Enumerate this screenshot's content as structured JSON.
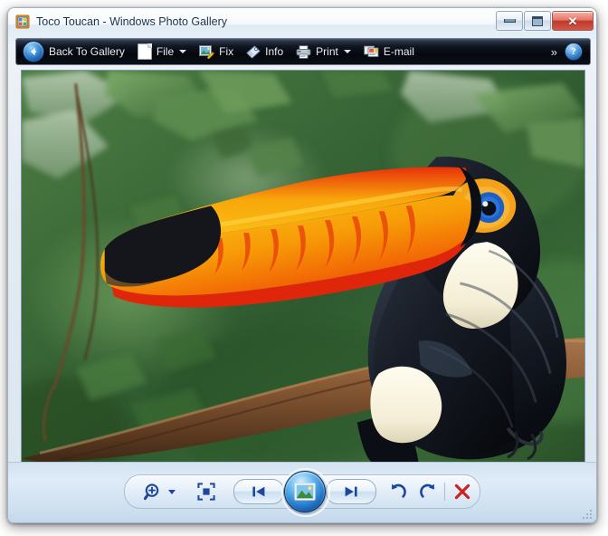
{
  "window": {
    "title": "Toco Toucan - Windows Photo Gallery",
    "icon": "photo-gallery-icon",
    "controls": {
      "minimize_label": "Minimize",
      "maximize_label": "Maximize",
      "close_label": "Close",
      "close_glyph": "✕"
    }
  },
  "toolbar": {
    "back_label": "Back To Gallery",
    "back_icon": "back-arrow-icon",
    "items": [
      {
        "label": "File",
        "icon": "file-page-icon",
        "has_menu": true
      },
      {
        "label": "Fix",
        "icon": "fix-picture-icon",
        "has_menu": false
      },
      {
        "label": "Info",
        "icon": "info-tag-icon",
        "has_menu": false
      },
      {
        "label": "Print",
        "icon": "printer-icon",
        "has_menu": true
      },
      {
        "label": "E-mail",
        "icon": "email-icon",
        "has_menu": false
      }
    ],
    "overflow_glyph": "»",
    "overflow_label": "More options",
    "help_glyph": "?",
    "help_label": "Help"
  },
  "photo": {
    "alt": "Toco Toucan perched on a branch with orange beak against green foliage",
    "subject": "Toco Toucan",
    "colors": {
      "beak_orange": "#F7A007",
      "beak_red": "#E8300B",
      "beak_tip_black": "#1A1A1A",
      "body_black": "#14161D",
      "throat_cream": "#F7F2DC",
      "eye_blue": "#1D5FC4",
      "eye_ring_orange": "#F08A14",
      "background_green": "#3E6B3A",
      "branch_brown": "#7A4A2B"
    }
  },
  "controls": {
    "zoom": {
      "label": "Zoom",
      "icon": "magnifier-plus-icon",
      "has_menu": true
    },
    "fit": {
      "label": "Fit to window",
      "icon": "fit-to-window-icon"
    },
    "previous": {
      "label": "Previous",
      "icon": "previous-icon",
      "glyph": "⏮"
    },
    "slideshow": {
      "label": "Play slide show",
      "icon": "slideshow-picture-icon"
    },
    "next": {
      "label": "Next",
      "icon": "next-icon",
      "glyph": "⏭"
    },
    "rotate_ccw": {
      "label": "Rotate counterclockwise",
      "icon": "rotate-ccw-icon",
      "glyph": "↺"
    },
    "rotate_cw": {
      "label": "Rotate clockwise",
      "icon": "rotate-cw-icon",
      "glyph": "↻"
    },
    "delete": {
      "label": "Delete",
      "icon": "delete-x-icon",
      "glyph": "✕"
    }
  },
  "theme": {
    "accent_blue": "#1B47A0",
    "delete_red": "#CC2222",
    "toolbar_dark": "#05070C",
    "panel_blue": "#D3E2F1"
  }
}
